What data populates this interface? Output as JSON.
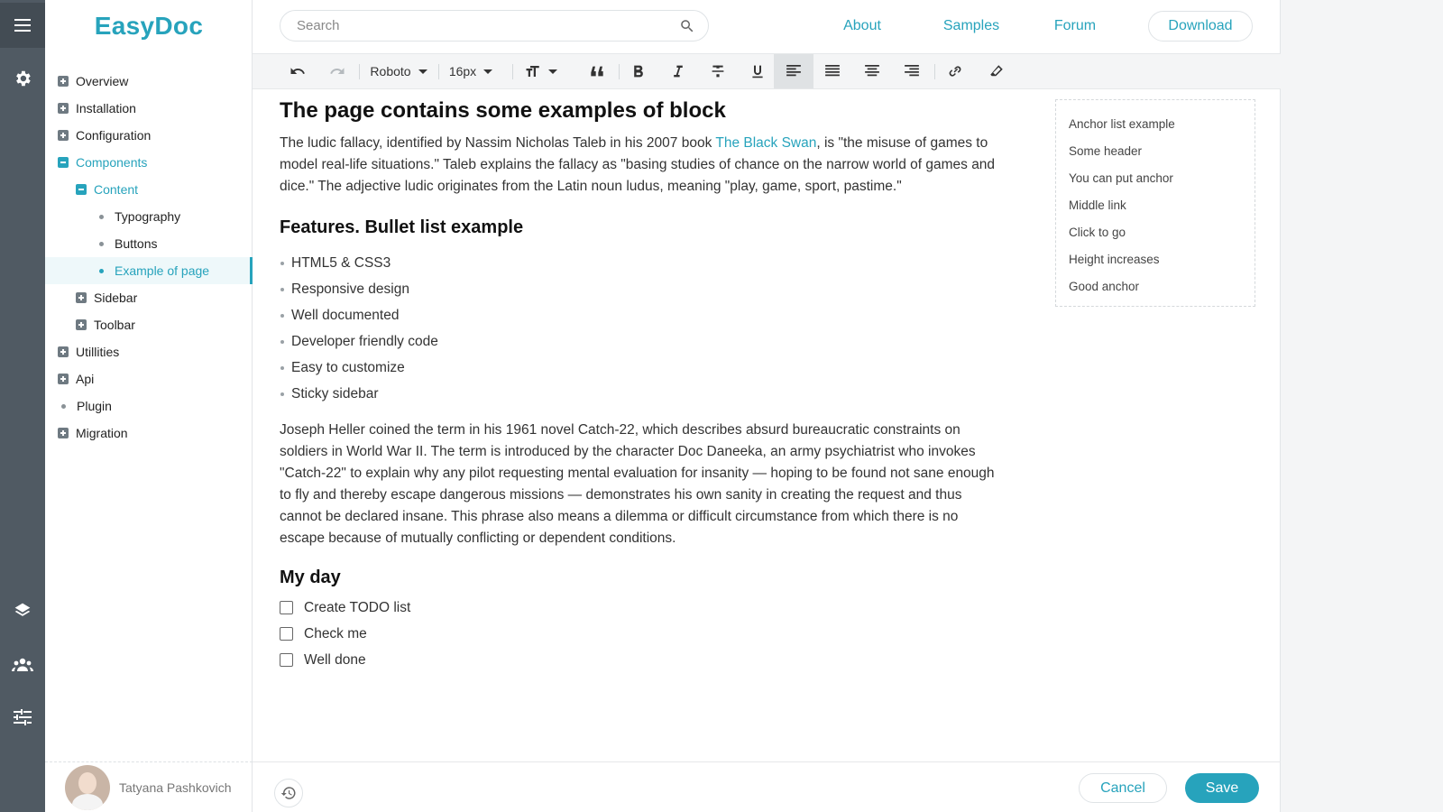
{
  "app": {
    "logo": "EasyDoc"
  },
  "rail": {
    "icons": [
      "menu-icon",
      "gear-icon",
      "layers-icon",
      "users-icon",
      "sliders-icon"
    ]
  },
  "sidebar": {
    "items": [
      {
        "label": "Overview",
        "icon": "plus-box-icon",
        "level": 0
      },
      {
        "label": "Installation",
        "icon": "plus-box-icon",
        "level": 0
      },
      {
        "label": "Configuration",
        "icon": "plus-box-icon",
        "level": 0
      },
      {
        "label": "Components",
        "icon": "minus-box-icon",
        "level": 0,
        "active": true
      },
      {
        "label": "Content",
        "icon": "minus-box-icon",
        "level": 1,
        "active": true
      },
      {
        "label": "Typography",
        "icon": "dot-icon",
        "level": 2
      },
      {
        "label": "Buttons",
        "icon": "dot-icon",
        "level": 2
      },
      {
        "label": "Example of page",
        "icon": "dot-icon",
        "level": 2,
        "active": true,
        "selected": true
      },
      {
        "label": "Sidebar",
        "icon": "plus-box-icon",
        "level": 1
      },
      {
        "label": "Toolbar",
        "icon": "plus-box-icon",
        "level": 1
      },
      {
        "label": "Utillities",
        "icon": "plus-box-icon",
        "level": 0
      },
      {
        "label": "Api",
        "icon": "plus-box-icon",
        "level": 0
      },
      {
        "label": "Plugin",
        "icon": "dot-icon",
        "level": 0
      },
      {
        "label": "Migration",
        "icon": "plus-box-icon",
        "level": 0
      }
    ],
    "user": {
      "name": "Tatyana Pashkovich"
    }
  },
  "header": {
    "search_placeholder": "Search",
    "nav": {
      "about": "About",
      "samples": "Samples",
      "forum": "Forum",
      "download": "Download"
    }
  },
  "toolbar": {
    "font": "Roboto",
    "size": "16px",
    "active_tool": "align-left"
  },
  "page": {
    "title": "The page contains some examples of block",
    "intro_before": "The ludic fallacy, identified by Nassim Nicholas Taleb in his 2007 book ",
    "intro_link": "The Black Swan",
    "intro_after": ", is \"the misuse of games to model real-life situations.\" Taleb explains the fallacy as \"basing studies of chance on the narrow world of games and dice.\" The adjective ludic originates from the Latin noun ludus, meaning \"play, game, sport, pastime.\"",
    "features_title": "Features. Bullet list example",
    "features": [
      "HTML5 & CSS3",
      "Responsive design",
      "Well documented",
      "Developer friendly code",
      "Easy to customize",
      "Sticky sidebar"
    ],
    "paragraph2": "Joseph Heller coined the term in his 1961 novel Catch-22, which describes absurd bureaucratic constraints on soldiers in World War II. The term is introduced by the character Doc Daneeka, an army psychiatrist who invokes \"Catch-22\" to explain why any pilot requesting mental evaluation for insanity — hoping to be found not sane enough to fly and thereby escape dangerous missions — demonstrates his own sanity in creating the request and thus cannot be declared insane. This phrase also means a dilemma or difficult circumstance from which there is no escape because of mutually conflicting or dependent conditions.",
    "day_title": "My day",
    "todos": [
      {
        "label": "Create TODO list",
        "checked": false
      },
      {
        "label": "Check me",
        "checked": false
      },
      {
        "label": "Well done",
        "checked": false
      }
    ]
  },
  "anchors": [
    "Anchor list example",
    "Some header",
    "You can put anchor",
    "Middle link",
    "Click to go",
    "Height increases",
    "Good anchor"
  ],
  "footer": {
    "cancel": "Cancel",
    "save": "Save"
  },
  "colors": {
    "accent": "#27a3bc",
    "rail": "#505a63"
  }
}
